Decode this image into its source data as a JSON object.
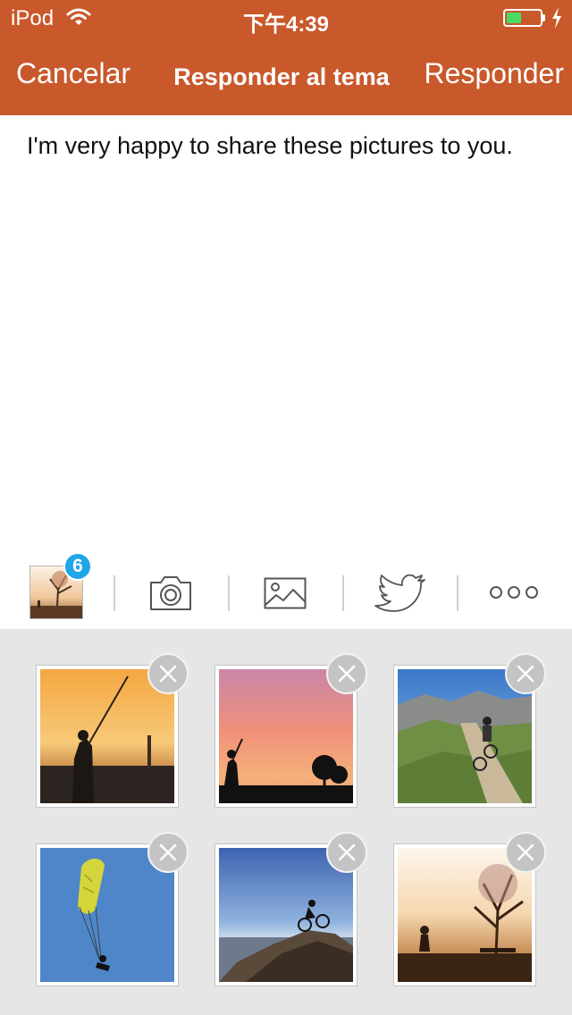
{
  "status_bar": {
    "carrier": "iPod",
    "time": "下午4:39",
    "battery_level": 0.45,
    "icons": [
      "wifi-icon",
      "battery-icon",
      "charging-bolt-icon"
    ]
  },
  "nav": {
    "cancel_label": "Cancelar",
    "title": "Responder al tema",
    "reply_label": "Responder"
  },
  "compose": {
    "text": "I'm very happy to share these pictures to you."
  },
  "toolbar": {
    "attachment_count": "6",
    "icons": [
      "photos-thumbnail-icon",
      "camera-icon",
      "image-gallery-icon",
      "twitter-bird-icon",
      "more-options-icon"
    ]
  },
  "attachments": [
    {
      "subject": "fisherman-silhouette",
      "icon": "close-icon"
    },
    {
      "subject": "golfer-sunset",
      "icon": "close-icon"
    },
    {
      "subject": "mountain-biker-trail",
      "icon": "close-icon"
    },
    {
      "subject": "paraglider",
      "icon": "close-icon"
    },
    {
      "subject": "cyclist-on-rock",
      "icon": "close-icon"
    },
    {
      "subject": "runner-by-lake",
      "icon": "close-icon"
    }
  ],
  "colors": {
    "brand": "#c9582b",
    "badge": "#1ea6e6",
    "tray_background": "#e6e6e6",
    "battery_fill": "#4cd964"
  }
}
